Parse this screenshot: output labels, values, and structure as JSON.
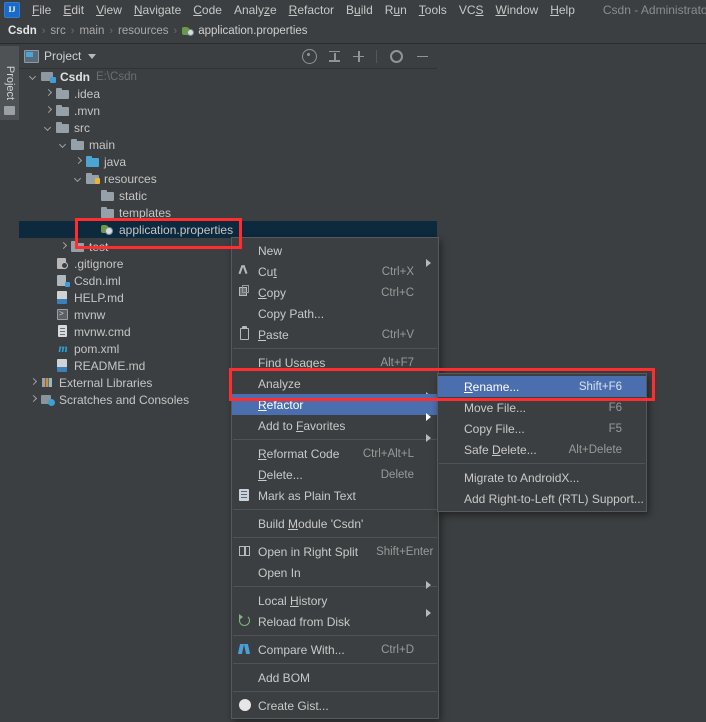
{
  "window": {
    "title": "Csdn - Administrator"
  },
  "menubar": {
    "items": [
      {
        "label": "File",
        "mnemonic": "F"
      },
      {
        "label": "Edit",
        "mnemonic": "E"
      },
      {
        "label": "View",
        "mnemonic": "V"
      },
      {
        "label": "Navigate",
        "mnemonic": "N"
      },
      {
        "label": "Code",
        "mnemonic": "C"
      },
      {
        "label": "Analyze",
        "mnemonic": "z"
      },
      {
        "label": "Refactor",
        "mnemonic": "R"
      },
      {
        "label": "Build",
        "mnemonic": "u"
      },
      {
        "label": "Run",
        "mnemonic": "u"
      },
      {
        "label": "Tools",
        "mnemonic": "T"
      },
      {
        "label": "VCS",
        "mnemonic": "S"
      },
      {
        "label": "Window",
        "mnemonic": "W"
      },
      {
        "label": "Help",
        "mnemonic": "H"
      }
    ]
  },
  "breadcrumb": {
    "root": "Csdn",
    "separator": "›",
    "crumbs": [
      "src",
      "main",
      "resources"
    ],
    "file": "application.properties"
  },
  "toolstrip": {
    "project_tab": "Project"
  },
  "panel": {
    "title": "Project",
    "tools": [
      "locate-icon",
      "collapse-all-icon",
      "expand-all-icon",
      "settings-gear-icon",
      "hide-icon"
    ]
  },
  "tree": {
    "nodes": [
      {
        "label": "Csdn",
        "hint": "E:\\Csdn",
        "depth": 0,
        "arrow": "down",
        "icon": "module",
        "bold": true,
        "selected": false
      },
      {
        "label": ".idea",
        "hint": "",
        "depth": 1,
        "arrow": "right",
        "icon": "folder",
        "bold": false,
        "selected": false
      },
      {
        "label": ".mvn",
        "hint": "",
        "depth": 1,
        "arrow": "right",
        "icon": "folder",
        "bold": false,
        "selected": false
      },
      {
        "label": "src",
        "hint": "",
        "depth": 1,
        "arrow": "down",
        "icon": "folder",
        "bold": false,
        "selected": false
      },
      {
        "label": "main",
        "hint": "",
        "depth": 2,
        "arrow": "down",
        "icon": "folder",
        "bold": false,
        "selected": false
      },
      {
        "label": "java",
        "hint": "",
        "depth": 3,
        "arrow": "right",
        "icon": "folder-blue",
        "bold": false,
        "selected": false
      },
      {
        "label": "resources",
        "hint": "",
        "depth": 3,
        "arrow": "down",
        "icon": "folder-res",
        "bold": false,
        "selected": false
      },
      {
        "label": "static",
        "hint": "",
        "depth": 4,
        "arrow": "none",
        "icon": "folder",
        "bold": false,
        "selected": false
      },
      {
        "label": "templates",
        "hint": "",
        "depth": 4,
        "arrow": "none",
        "icon": "folder",
        "bold": false,
        "selected": false
      },
      {
        "label": "application.properties",
        "hint": "",
        "depth": 4,
        "arrow": "none",
        "icon": "props",
        "bold": false,
        "selected": true
      },
      {
        "label": "test",
        "hint": "",
        "depth": 2,
        "arrow": "right",
        "icon": "folder",
        "bold": false,
        "selected": false
      },
      {
        "label": ".gitignore",
        "hint": "",
        "depth": 1,
        "arrow": "none",
        "icon": "git",
        "bold": false,
        "selected": false
      },
      {
        "label": "Csdn.iml",
        "hint": "",
        "depth": 1,
        "arrow": "none",
        "icon": "iml",
        "bold": false,
        "selected": false
      },
      {
        "label": "HELP.md",
        "hint": "",
        "depth": 1,
        "arrow": "none",
        "icon": "md",
        "bold": false,
        "selected": false
      },
      {
        "label": "mvnw",
        "hint": "",
        "depth": 1,
        "arrow": "none",
        "icon": "sh",
        "bold": false,
        "selected": false
      },
      {
        "label": "mvnw.cmd",
        "hint": "",
        "depth": 1,
        "arrow": "none",
        "icon": "cmd",
        "bold": false,
        "selected": false
      },
      {
        "label": "pom.xml",
        "hint": "",
        "depth": 1,
        "arrow": "none",
        "icon": "mvn",
        "bold": false,
        "selected": false
      },
      {
        "label": "README.md",
        "hint": "",
        "depth": 1,
        "arrow": "none",
        "icon": "md",
        "bold": false,
        "selected": false
      },
      {
        "label": "External Libraries",
        "hint": "",
        "depth": 0,
        "arrow": "right",
        "icon": "lib",
        "bold": false,
        "selected": false
      },
      {
        "label": "Scratches and Consoles",
        "hint": "",
        "depth": 0,
        "arrow": "right",
        "icon": "scratch",
        "bold": false,
        "selected": false
      }
    ]
  },
  "context_menu": {
    "items": [
      {
        "label": "New",
        "mnemonic": "",
        "shortcut": "",
        "icon": "",
        "submenu": true,
        "separator_after": false,
        "selected": false
      },
      {
        "label": "Cut",
        "mnemonic": "t",
        "shortcut": "Ctrl+X",
        "icon": "cut-icon",
        "submenu": false,
        "separator_after": false,
        "selected": false
      },
      {
        "label": "Copy",
        "mnemonic": "C",
        "shortcut": "Ctrl+C",
        "icon": "copy-icon",
        "submenu": false,
        "separator_after": false,
        "selected": false
      },
      {
        "label": "Copy Path...",
        "mnemonic": "",
        "shortcut": "",
        "icon": "",
        "submenu": false,
        "separator_after": false,
        "selected": false
      },
      {
        "label": "Paste",
        "mnemonic": "P",
        "shortcut": "Ctrl+V",
        "icon": "paste-icon",
        "submenu": false,
        "separator_after": true,
        "selected": false
      },
      {
        "label": "Find Usages",
        "mnemonic": "U",
        "shortcut": "Alt+F7",
        "icon": "",
        "submenu": false,
        "separator_after": false,
        "selected": false
      },
      {
        "label": "Analyze",
        "mnemonic": "",
        "shortcut": "",
        "icon": "",
        "submenu": true,
        "separator_after": false,
        "selected": false
      },
      {
        "label": "Refactor",
        "mnemonic": "R",
        "shortcut": "",
        "icon": "",
        "submenu": true,
        "separator_after": false,
        "selected": true
      },
      {
        "label": "Add to Favorites",
        "mnemonic": "F",
        "shortcut": "",
        "icon": "",
        "submenu": true,
        "separator_after": true,
        "selected": false
      },
      {
        "label": "Reformat Code",
        "mnemonic": "R",
        "shortcut": "Ctrl+Alt+L",
        "icon": "",
        "submenu": false,
        "separator_after": false,
        "selected": false
      },
      {
        "label": "Delete...",
        "mnemonic": "D",
        "shortcut": "Delete",
        "icon": "",
        "submenu": false,
        "separator_after": false,
        "selected": false
      },
      {
        "label": "Mark as Plain Text",
        "mnemonic": "",
        "shortcut": "",
        "icon": "plain-text-icon",
        "submenu": false,
        "separator_after": true,
        "selected": false
      },
      {
        "label": "Build Module 'Csdn'",
        "mnemonic": "M",
        "shortcut": "",
        "icon": "",
        "submenu": false,
        "separator_after": true,
        "selected": false
      },
      {
        "label": "Open in Right Split",
        "mnemonic": "",
        "shortcut": "Shift+Enter",
        "icon": "split-icon",
        "submenu": false,
        "separator_after": false,
        "selected": false
      },
      {
        "label": "Open In",
        "mnemonic": "",
        "shortcut": "",
        "icon": "",
        "submenu": true,
        "separator_after": true,
        "selected": false
      },
      {
        "label": "Local History",
        "mnemonic": "H",
        "shortcut": "",
        "icon": "",
        "submenu": true,
        "separator_after": false,
        "selected": false
      },
      {
        "label": "Reload from Disk",
        "mnemonic": "",
        "shortcut": "",
        "icon": "reload-icon",
        "submenu": false,
        "separator_after": true,
        "selected": false
      },
      {
        "label": "Compare With...",
        "mnemonic": "",
        "shortcut": "Ctrl+D",
        "icon": "compare-icon",
        "submenu": false,
        "separator_after": true,
        "selected": false
      },
      {
        "label": "Add BOM",
        "mnemonic": "",
        "shortcut": "",
        "icon": "",
        "submenu": false,
        "separator_after": true,
        "selected": false
      },
      {
        "label": "Create Gist...",
        "mnemonic": "",
        "shortcut": "",
        "icon": "gist-icon",
        "submenu": false,
        "separator_after": false,
        "selected": false
      }
    ]
  },
  "refactor_submenu": {
    "items": [
      {
        "label": "Rename...",
        "mnemonic": "R",
        "shortcut": "Shift+F6",
        "separator_after": false,
        "selected": true
      },
      {
        "label": "Move File...",
        "mnemonic": "",
        "shortcut": "F6",
        "separator_after": false,
        "selected": false
      },
      {
        "label": "Copy File...",
        "mnemonic": "",
        "shortcut": "F5",
        "separator_after": false,
        "selected": false
      },
      {
        "label": "Safe Delete...",
        "mnemonic": "D",
        "shortcut": "Alt+Delete",
        "separator_after": true,
        "selected": false
      },
      {
        "label": "Migrate to AndroidX...",
        "mnemonic": "",
        "shortcut": "",
        "separator_after": false,
        "selected": false
      },
      {
        "label": "Add Right-to-Left (RTL) Support...",
        "mnemonic": "",
        "shortcut": "",
        "separator_after": false,
        "selected": false
      }
    ]
  },
  "colors": {
    "background": "#3c3f41",
    "editor_background": "#2b2b2b",
    "selection_blue": "#4b6eaf",
    "tree_selection": "#0d293e",
    "highlight_red": "#ff2d2d",
    "text": "#c5c5c5",
    "dim_text": "#6b6e70"
  },
  "annotations": {
    "highlight_boxes": [
      {
        "name": "application-properties-highlight"
      },
      {
        "name": "refactor-rename-highlight"
      }
    ]
  }
}
